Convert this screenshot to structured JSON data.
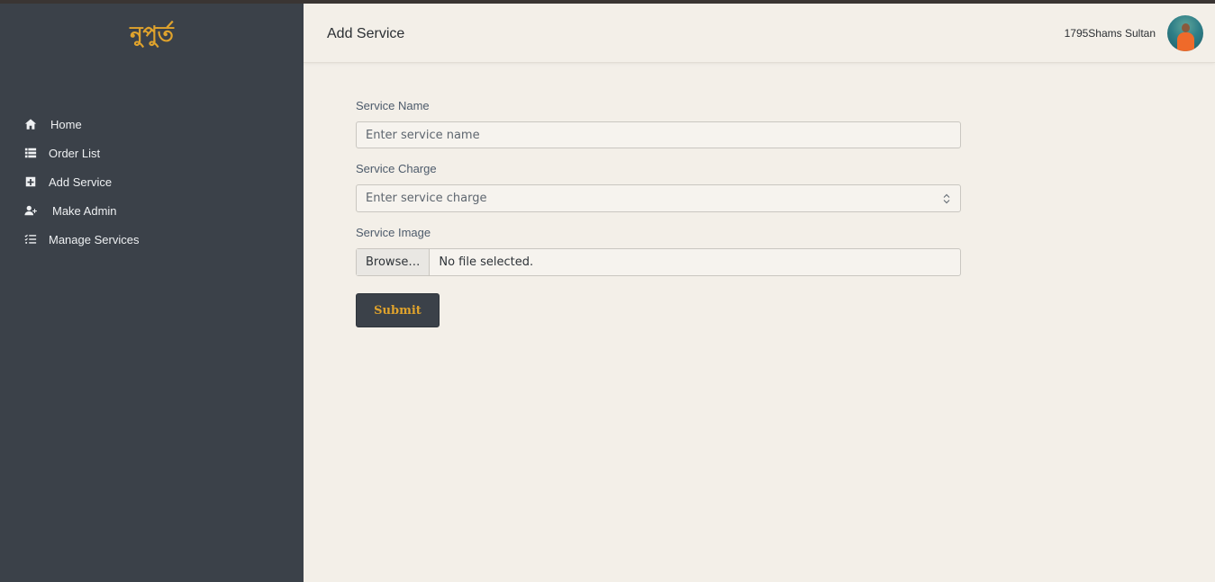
{
  "sidebar": {
    "logo_text": "নুপুর্ত",
    "items": [
      {
        "label": "Home",
        "icon": "home-icon"
      },
      {
        "label": "Order List",
        "icon": "list-icon"
      },
      {
        "label": "Add Service",
        "icon": "plus-square-icon"
      },
      {
        "label": "Make Admin",
        "icon": "user-plus-icon"
      },
      {
        "label": "Manage Services",
        "icon": "tasks-icon"
      }
    ]
  },
  "header": {
    "title": "Add Service",
    "user_name": "1795Shams Sultan"
  },
  "form": {
    "service_name": {
      "label": "Service Name",
      "placeholder": "Enter service name",
      "value": ""
    },
    "service_charge": {
      "label": "Service Charge",
      "placeholder": "Enter service charge",
      "value": ""
    },
    "service_image": {
      "label": "Service Image",
      "browse_label": "Browse…",
      "file_text": "No file selected."
    },
    "submit_label": "Submit"
  },
  "colors": {
    "sidebar_bg": "#3b4149",
    "accent": "#e0a32c",
    "page_bg": "#f3efe8"
  }
}
